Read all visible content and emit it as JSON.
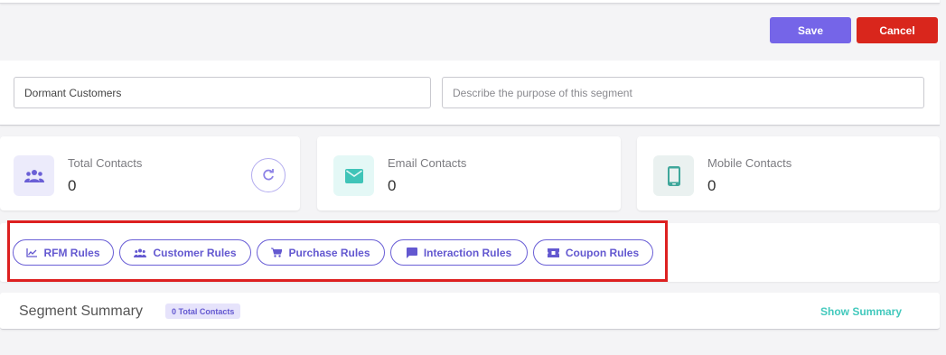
{
  "toolbar": {
    "save_label": "Save",
    "cancel_label": "Cancel"
  },
  "segment": {
    "name_value": "Dormant Customers",
    "description_placeholder": "Describe the purpose of this segment"
  },
  "stats": [
    {
      "label": "Total Contacts",
      "value": "0",
      "icon": "users-icon"
    },
    {
      "label": "Email Contacts",
      "value": "0",
      "icon": "mail-icon"
    },
    {
      "label": "Mobile Contacts",
      "value": "0",
      "icon": "mobile-icon"
    }
  ],
  "rules": [
    {
      "label": "RFM Rules",
      "icon": "chart-line-icon"
    },
    {
      "label": "Customer Rules",
      "icon": "users-icon"
    },
    {
      "label": "Purchase Rules",
      "icon": "cart-icon"
    },
    {
      "label": "Interaction Rules",
      "icon": "chat-icon"
    },
    {
      "label": "Coupon Rules",
      "icon": "ticket-icon"
    }
  ],
  "summary": {
    "title": "Segment Summary",
    "badge": "0 Total Contacts",
    "toggle_label": "Show Summary"
  },
  "colors": {
    "accent": "#7565e8",
    "danger": "#d9261c",
    "teal": "#43c9bd",
    "highlight": "#dd2020"
  }
}
